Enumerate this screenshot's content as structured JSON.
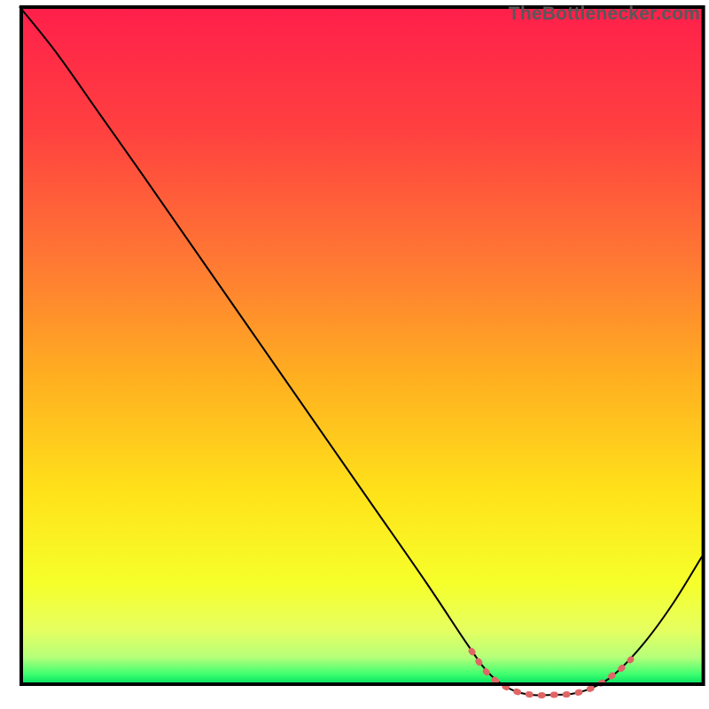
{
  "watermark": "TheBottlenecker.com",
  "chart_data": {
    "type": "line",
    "title": "",
    "xlabel": "",
    "ylabel": "",
    "xlim": [
      0,
      100
    ],
    "ylim": [
      0,
      100
    ],
    "series": [
      {
        "name": "bottleneck-curve",
        "stroke": "#000000",
        "stroke_width": 2,
        "points": [
          {
            "x": 2.8,
            "y": 99.0
          },
          {
            "x": 8.0,
            "y": 92.5
          },
          {
            "x": 14.0,
            "y": 84.0
          },
          {
            "x": 20.0,
            "y": 75.5
          },
          {
            "x": 28.0,
            "y": 64.0
          },
          {
            "x": 36.0,
            "y": 52.5
          },
          {
            "x": 44.0,
            "y": 41.0
          },
          {
            "x": 52.0,
            "y": 29.5
          },
          {
            "x": 60.0,
            "y": 18.0
          },
          {
            "x": 66.0,
            "y": 9.0
          },
          {
            "x": 69.0,
            "y": 5.0
          },
          {
            "x": 72.0,
            "y": 2.8
          },
          {
            "x": 75.0,
            "y": 2.0
          },
          {
            "x": 78.0,
            "y": 2.0
          },
          {
            "x": 81.0,
            "y": 2.2
          },
          {
            "x": 84.0,
            "y": 3.2
          },
          {
            "x": 87.0,
            "y": 5.2
          },
          {
            "x": 91.0,
            "y": 9.5
          },
          {
            "x": 95.0,
            "y": 15.0
          },
          {
            "x": 99.0,
            "y": 21.5
          }
        ]
      },
      {
        "name": "optimal-band",
        "stroke": "#e06666",
        "stroke_width": 7,
        "points": [
          {
            "x": 66.5,
            "y": 8.2
          },
          {
            "x": 69.0,
            "y": 4.8
          },
          {
            "x": 72.0,
            "y": 2.8
          },
          {
            "x": 75.0,
            "y": 2.0
          },
          {
            "x": 78.0,
            "y": 2.0
          },
          {
            "x": 81.0,
            "y": 2.2
          },
          {
            "x": 84.0,
            "y": 3.2
          },
          {
            "x": 87.0,
            "y": 5.2
          },
          {
            "x": 89.0,
            "y": 7.0
          }
        ]
      }
    ],
    "gradient_stops": [
      {
        "offset": 0.0,
        "color": "#ff1f4b"
      },
      {
        "offset": 0.18,
        "color": "#ff4040"
      },
      {
        "offset": 0.38,
        "color": "#ff7a33"
      },
      {
        "offset": 0.55,
        "color": "#ffb020"
      },
      {
        "offset": 0.72,
        "color": "#ffe31a"
      },
      {
        "offset": 0.85,
        "color": "#f6ff2a"
      },
      {
        "offset": 0.92,
        "color": "#e6ff60"
      },
      {
        "offset": 0.96,
        "color": "#b6ff7a"
      },
      {
        "offset": 0.985,
        "color": "#40ff70"
      },
      {
        "offset": 1.0,
        "color": "#00e060"
      }
    ],
    "background_rect": {
      "x": 3.0,
      "y": 3.5,
      "w": 96.2,
      "h": 95.5
    },
    "border": {
      "stroke": "#000000",
      "stroke_width": 4
    }
  }
}
